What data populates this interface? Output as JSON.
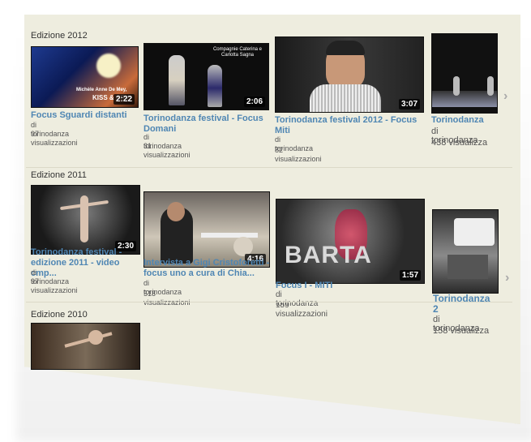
{
  "sections": [
    {
      "title": "Edizione 2012",
      "videos": [
        {
          "title": "Focus Sguardi distanti",
          "author": "di torinodanza",
          "views": "97 visualizzazioni",
          "duration": "2:22"
        },
        {
          "title": "Torinodanza festival - Focus Domani",
          "author": "di torinodanza",
          "views": "31 visualizzazioni",
          "duration": "2:06",
          "overlay": "Compagnie Caterina e Carlotta Sagna"
        },
        {
          "title": "Torinodanza festival 2012 - Focus Miti",
          "author": "di torinodanza",
          "views": "82 visualizzazioni",
          "duration": "3:07"
        },
        {
          "title": "Torinodanza",
          "author": "di torinodanza",
          "views": "438 visualizza"
        }
      ]
    },
    {
      "title": "Edizione 2011",
      "videos": [
        {
          "title": "Torinodanza festival -edizione 2011 - video cmp...",
          "author": "di torinodanza",
          "views": "97 visualizzazioni",
          "duration": "2:30"
        },
        {
          "title": "Intervista a Gigi Cristoforetti - focus uno a cura di Chia...",
          "author": "di torinodanza",
          "views": "518 visualizzazioni",
          "duration": "4:16"
        },
        {
          "title": "Focus I - MITI",
          "author": "di torinodanza",
          "views": "159 visualizzazioni",
          "duration": "1:57",
          "overlay": "BARTA"
        },
        {
          "title": "Torinodanza 2",
          "author": "di torinodanza",
          "views": "158 visualizza"
        }
      ]
    },
    {
      "title": "Edizione 2010",
      "videos": []
    }
  ],
  "icons": {
    "next": "chevron-right-icon"
  }
}
